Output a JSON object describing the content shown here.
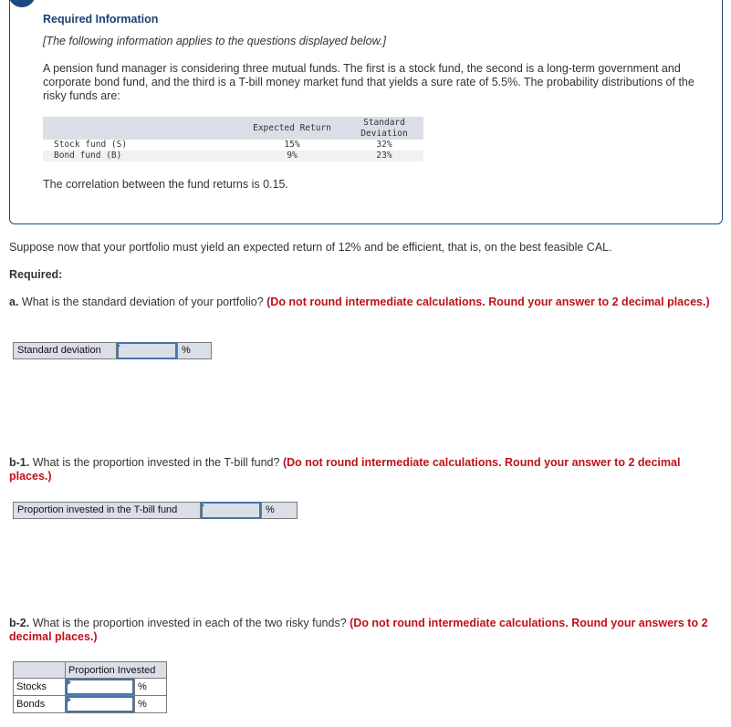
{
  "info": {
    "title": "Required Information",
    "note": "[The following information applies to the questions displayed below.]",
    "paragraph": "A pension fund manager is considering three mutual funds. The first is a stock fund, the second is a long-term government and corporate bond fund, and the third is a T-bill money market fund that yields a sure rate of 5.5%. The probability distributions of the risky funds are:",
    "table": {
      "headers": [
        "",
        "Expected Return",
        "Standard Deviation"
      ],
      "rows": [
        {
          "name": "Stock fund (S)",
          "expected_return": "15%",
          "std_dev": "32%"
        },
        {
          "name": "Bond fund (B)",
          "expected_return": "9%",
          "std_dev": "23%"
        }
      ]
    },
    "correlation_text": "The correlation between the fund returns is 0.15."
  },
  "suppose_text": "Suppose now that your portfolio must yield an expected return of 12% and be efficient, that is, on the best feasible CAL.",
  "required_label": "Required:",
  "questions": {
    "a": {
      "label": "a.",
      "text": " What is the standard deviation of your portfolio? ",
      "note": "(Do not round intermediate calculations. Round your answer to 2 decimal places.)",
      "field_label": "Standard deviation",
      "value": "",
      "unit": "%"
    },
    "b1": {
      "label": "b-1.",
      "text": " What is the proportion invested in the T-bill fund? ",
      "note": "(Do not round intermediate calculations. Round your answer to 2 decimal places.)",
      "field_label": "Proportion invested in the T-bill fund",
      "value": "",
      "unit": "%"
    },
    "b2": {
      "label": "b-2.",
      "text": " What is the proportion invested in each of the two risky funds? ",
      "note": "(Do not round intermediate calculations. Round your answers to 2 decimal places.)",
      "table_header": "Proportion Invested",
      "rows": [
        {
          "label": "Stocks",
          "value": "",
          "unit": "%"
        },
        {
          "label": "Bonds",
          "value": "",
          "unit": "%"
        }
      ]
    }
  }
}
